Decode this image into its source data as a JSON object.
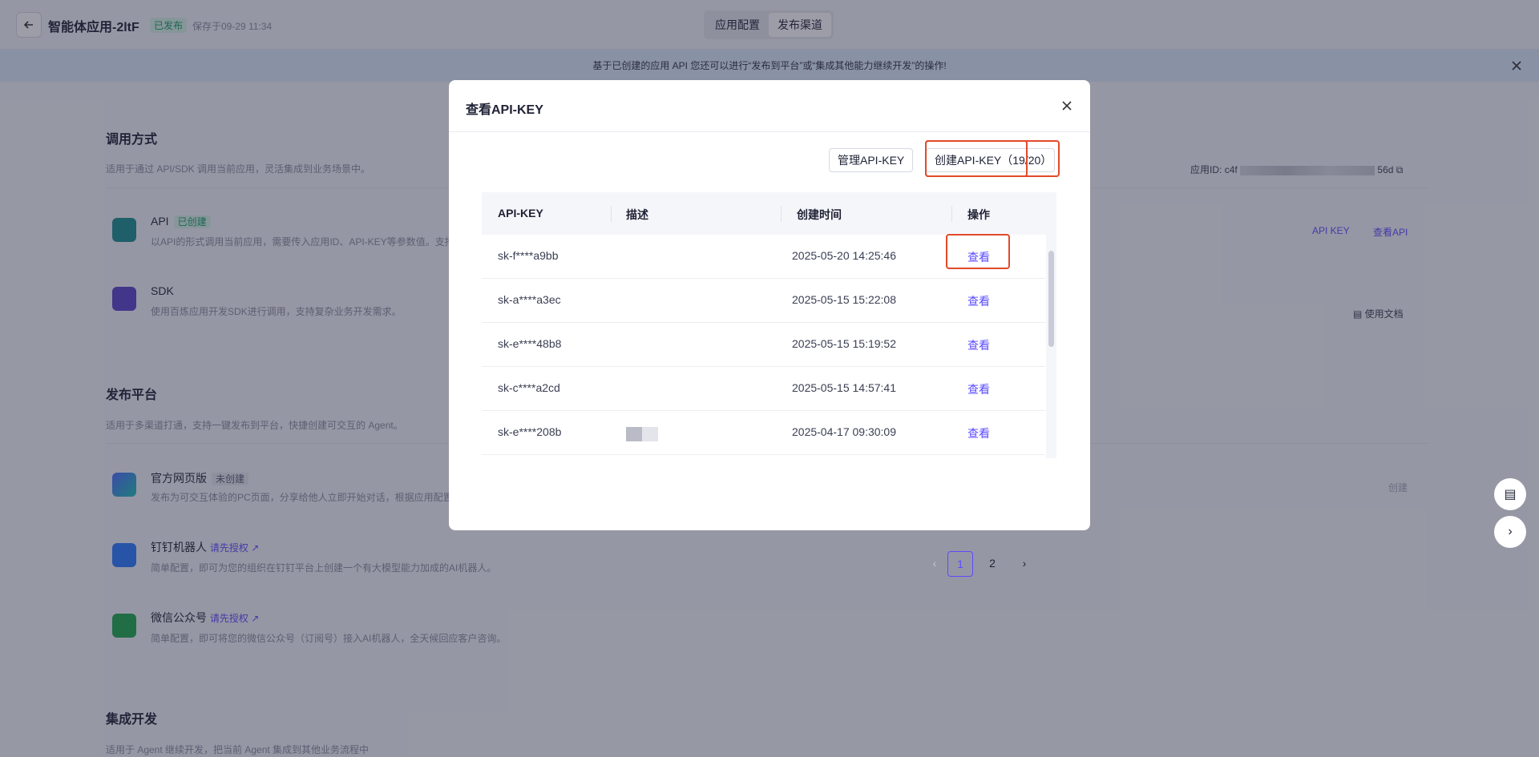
{
  "app": {
    "title": "智能体应用-2ltF",
    "status": "已发布",
    "saved": "保存于09-29 11:34"
  },
  "tabs": [
    "应用配置",
    "发布渠道"
  ],
  "banner": "基于已创建的应用 API 您还可以进行“发布到平台”或“集成其他能力继续开发”的操作!",
  "invoke": {
    "title": "调用方式",
    "desc": "适用于通过 API/SDK 调用当前应用，灵活集成到业务场景中。",
    "app_id_label": "应用ID:",
    "app_id_prefix": "c4f",
    "app_id_suffix": "56d",
    "api": {
      "title": "API",
      "tag": "已创建",
      "desc": "以API的形式调用当前应用，需要传入应用ID、API-KEY等参数值。支持",
      "link1": "API KEY",
      "link2": "查看API"
    },
    "sdk": {
      "title": "SDK",
      "desc": "使用百炼应用开发SDK进行调用，支持复杂业务开发需求。",
      "doc": "使用文档"
    }
  },
  "publish": {
    "title": "发布平台",
    "desc": "适用于多渠道打通，支持一键发布到平台，快捷创建可交互的 Agent。",
    "web": {
      "title": "官方网页版",
      "tag": "未创建",
      "desc": "发布为可交互体验的PC页面，分享给他人立即开始对话，根据应用配置",
      "action": "创建"
    },
    "dingtalk": {
      "title": "钉钉机器人",
      "link": "请先授权 ↗",
      "desc": "简单配置，即可为您的组织在钉钉平台上创建一个有大模型能力加成的AI机器人。"
    },
    "wechat": {
      "title": "微信公众号",
      "link": "请先授权 ↗",
      "desc": "简单配置，即可将您的微信公众号（订阅号）接入AI机器人，全天候回应客户咨询。"
    }
  },
  "integrate": {
    "title": "集成开发",
    "desc": "适用于 Agent 继续开发，把当前 Agent 集成到其他业务流程中"
  },
  "modal": {
    "title": "查看API-KEY",
    "manage_btn": "管理API-KEY",
    "create_btn": "创建API-KEY（19/20）",
    "columns": [
      "API-KEY",
      "描述",
      "创建时间",
      "操作"
    ],
    "rows": [
      {
        "key": "sk-f****a9bb",
        "created": "2025-05-20 14:25:46",
        "action": "查看"
      },
      {
        "key": "sk-a****a3ec",
        "created": "2025-05-15 15:22:08",
        "action": "查看"
      },
      {
        "key": "sk-e****48b8",
        "created": "2025-05-15 15:19:52",
        "action": "查看"
      },
      {
        "key": "sk-c****a2cd",
        "created": "2025-05-15 14:57:41",
        "action": "查看"
      },
      {
        "key": "sk-e****208b",
        "created": "2025-04-17 09:30:09",
        "action": "查看"
      }
    ],
    "pages": [
      "1",
      "2"
    ]
  },
  "colors": {
    "accent": "#5b4bff",
    "highlight": "#e24a2a",
    "success": "#1a9c63"
  }
}
